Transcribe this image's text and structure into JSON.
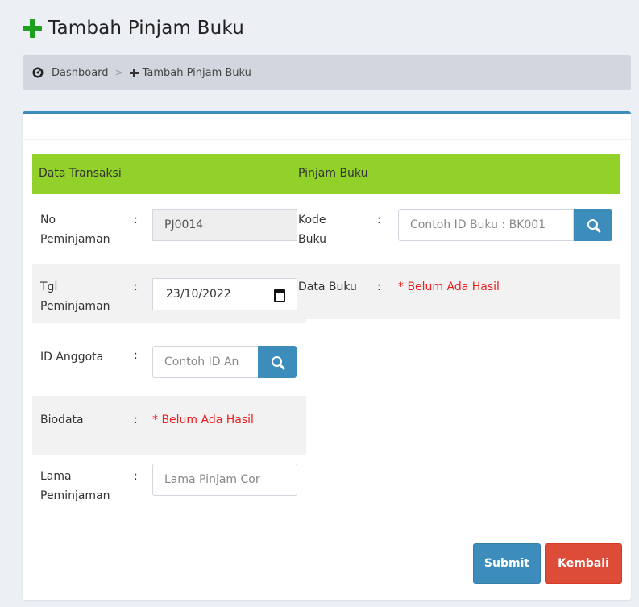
{
  "header": {
    "title": "Tambah Pinjam Buku"
  },
  "breadcrumb": {
    "home": "Dashboard",
    "separator": ">",
    "current": "Tambah Pinjam Buku"
  },
  "form": {
    "section_left": "Data Transaksi",
    "section_right": "Pinjam Buku",
    "colon": ":",
    "no_peminjaman": {
      "label_line1": "No",
      "label_line2": "Peminjaman",
      "value": "PJ0014"
    },
    "tgl_peminjaman": {
      "label_line1": "Tgl",
      "label_line2": "Peminjaman",
      "value": "23/10/2022"
    },
    "id_anggota": {
      "label": "ID Anggota",
      "placeholder": "Contoh ID An"
    },
    "biodata": {
      "label": "Biodata",
      "value": "* Belum Ada Hasil"
    },
    "lama_peminjaman": {
      "label_line1": "Lama",
      "label_line2": "Peminjaman",
      "placeholder": "Lama Pinjam Cor"
    },
    "kode_buku": {
      "label_line1": "Kode",
      "label_line2": "Buku",
      "placeholder": "Contoh ID Buku : BK001"
    },
    "data_buku": {
      "label": "Data Buku",
      "value": "* Belum Ada Hasil"
    }
  },
  "buttons": {
    "submit": "Submit",
    "kembali": "Kembali"
  },
  "icons": {
    "title": "plus-icon",
    "breadcrumb_home": "dashboard-icon",
    "breadcrumb_current": "plus-icon",
    "search": "search-icon",
    "date": "calendar-icon"
  },
  "colors": {
    "green_bar": "#92d02a",
    "primary": "#3c8dbc",
    "danger": "#dd4b39",
    "plus": "#1ea01e",
    "required": "#ee1c1c"
  }
}
